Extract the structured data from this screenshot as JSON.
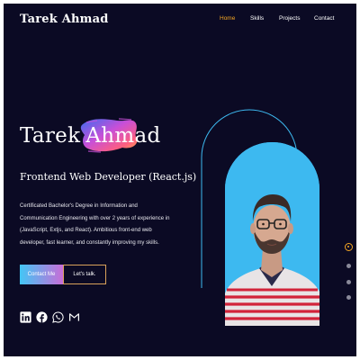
{
  "header": {
    "logo": "Tarek Ahmad",
    "nav": [
      {
        "label": "Home",
        "active": true
      },
      {
        "label": "Skills",
        "active": false
      },
      {
        "label": "Projects",
        "active": false
      },
      {
        "label": "Contact",
        "active": false
      }
    ]
  },
  "hero": {
    "first_name": "Tarek",
    "last_name": "Ahmad",
    "role": "Frontend Web Developer (React.js)",
    "bio": "Certificated Bachelor's Degree in Information and Communication Engineering with over 2 years of experience in (JavaScript, Extjs, and React). Ambitious front-end web developer, fast learner, and constantly improving my skills.",
    "buttons": {
      "contact": "Contact Me",
      "talk": "Let's talk."
    },
    "socials": [
      "linkedin-icon",
      "facebook-icon",
      "whatsapp-icon",
      "gmail-icon"
    ]
  },
  "carousel": {
    "slides": 4,
    "active_index": 0
  },
  "colors": {
    "background": "#0b0a24",
    "accent": "#f5a623",
    "arch": "#3db9f0",
    "button_gradient": [
      "#43c6f5",
      "#c86dd7"
    ]
  }
}
